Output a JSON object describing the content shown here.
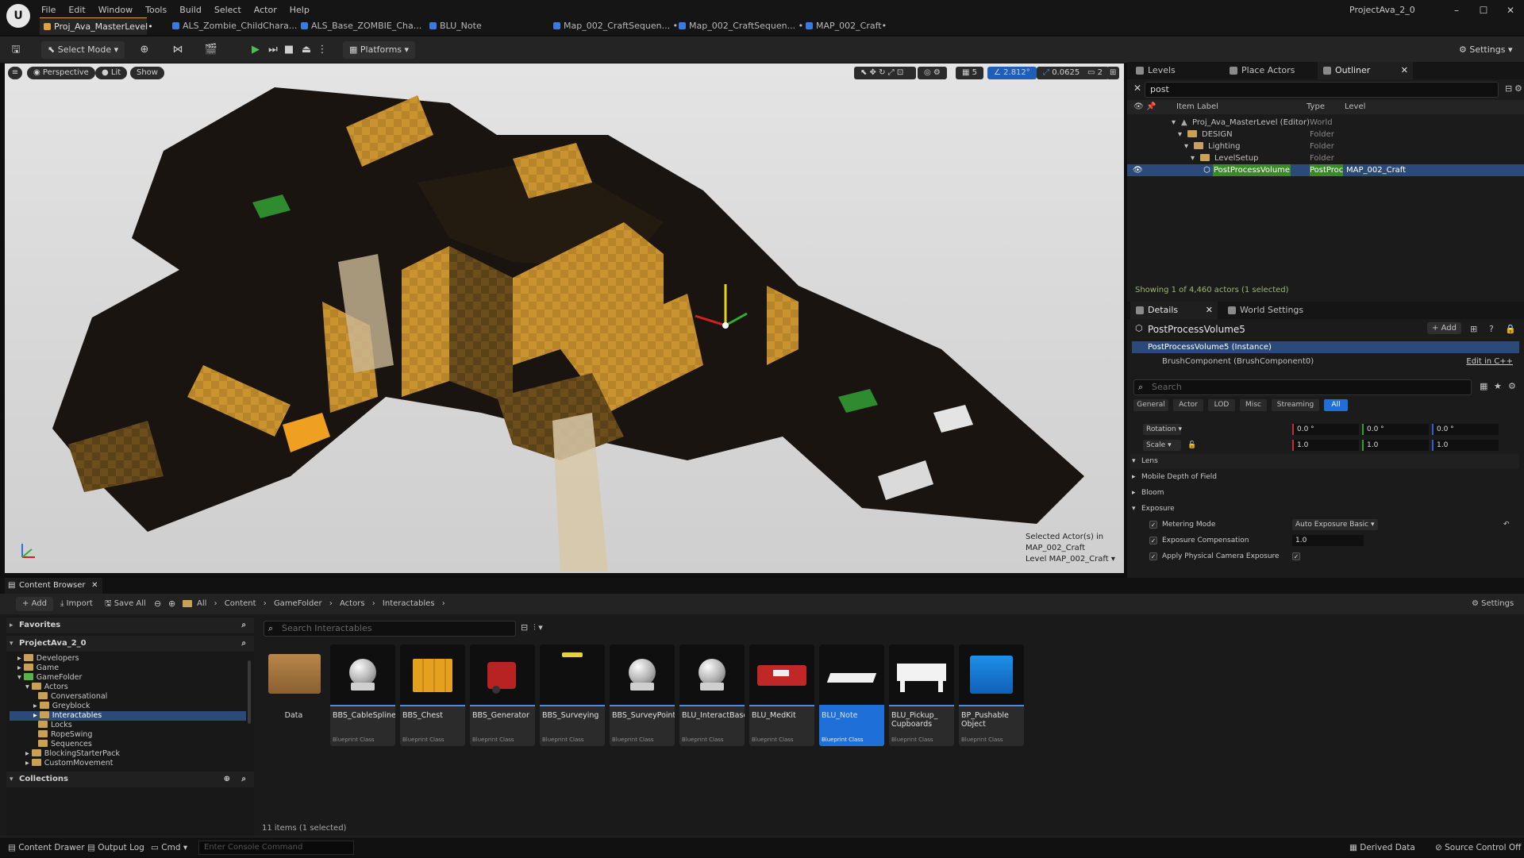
{
  "menu": {
    "items": [
      "File",
      "Edit",
      "Window",
      "Tools",
      "Build",
      "Select",
      "Actor",
      "Help"
    ],
    "project_name": "ProjectAva_2_0"
  },
  "tabs": [
    {
      "label": "Proj_Ava_MasterLevel•",
      "color": "#e0a040"
    },
    {
      "label": "ALS_Zombie_ChildChara...",
      "color": "#3a7be0"
    },
    {
      "label": "ALS_Base_ZOMBIE_Cha...",
      "color": "#3a7be0"
    },
    {
      "label": "BLU_Note",
      "color": "#3a7be0"
    },
    {
      "label": "Map_002_CraftSequen... •",
      "color": "#3a7be0"
    },
    {
      "label": "Map_002_CraftSequen... •",
      "color": "#3a7be0"
    },
    {
      "label": "MAP_002_Craft•",
      "color": "#3a7be0"
    }
  ],
  "toolbar": {
    "select_mode": "Select Mode",
    "platforms": "Platforms",
    "settings": "Settings"
  },
  "viewport": {
    "perspective": "Perspective",
    "lit": "Lit",
    "show": "Show",
    "grid_size": "5",
    "rotation_snap": "2.812°",
    "scale_snap": "0.0625",
    "camera_speed": "2",
    "selected_info_line1": "Selected Actor(s) in",
    "selected_info_line2": "MAP_002_Craft",
    "level_label": "Level",
    "level_value": "MAP_002_Craft"
  },
  "outliner": {
    "tabs": [
      "Levels",
      "Place Actors",
      "Outliner"
    ],
    "search_value": "post",
    "col_item": "Item Label",
    "col_type": "Type",
    "col_level": "Level",
    "rows": [
      {
        "label": "Proj_Ava_MasterLevel (Editor)",
        "type": "World",
        "level": ""
      },
      {
        "label": "DESIGN",
        "type": "Folder",
        "level": ""
      },
      {
        "label": "Lighting",
        "type": "Folder",
        "level": ""
      },
      {
        "label": "LevelSetup",
        "type": "Folder",
        "level": ""
      },
      {
        "label": "PostProcessVolume",
        "type": "PostProc",
        "level": "MAP_002_Craft"
      }
    ],
    "status": "Showing 1 of 4,460 actors (1 selected)"
  },
  "details": {
    "tabs": [
      "Details",
      "World Settings"
    ],
    "actor_name": "PostProcessVolume5",
    "add_label": "Add",
    "instance": "PostProcessVolume5 (Instance)",
    "component": "BrushComponent (BrushComponent0)",
    "edit_cpp": "Edit in C++",
    "search_placeholder": "Search",
    "filters": [
      "General",
      "Actor",
      "LOD",
      "Misc",
      "Streaming",
      "All"
    ],
    "rotation_label": "Rotation",
    "rotation": [
      "0.0 °",
      "0.0 °",
      "0.0 °"
    ],
    "scale_label": "Scale",
    "scale": [
      "1.0",
      "1.0",
      "1.0"
    ],
    "sections": [
      "Lens",
      "Mobile Depth of Field",
      "Bloom",
      "Exposure"
    ],
    "metering_mode_label": "Metering Mode",
    "metering_mode_value": "Auto Exposure Basic",
    "exposure_comp_label": "Exposure Compensation",
    "exposure_comp_value": "1.0",
    "physical_cam_label": "Apply Physical Camera Exposure"
  },
  "content_browser": {
    "tab": "Content Browser",
    "add": "Add",
    "import": "Import",
    "save_all": "Save All",
    "breadcrumb": [
      "All",
      "Content",
      "GameFolder",
      "Actors",
      "Interactables"
    ],
    "settings": "Settings",
    "favorites": "Favorites",
    "project": "ProjectAva_2_0",
    "collections": "Collections",
    "search_placeholder": "Search Interactables",
    "tree": [
      {
        "label": "Developers",
        "depth": 1
      },
      {
        "label": "Game",
        "depth": 1
      },
      {
        "label": "GameFolder",
        "depth": 1
      },
      {
        "label": "Actors",
        "depth": 2
      },
      {
        "label": "Conversational",
        "depth": 3
      },
      {
        "label": "Greyblock",
        "depth": 3
      },
      {
        "label": "Interactables",
        "depth": 3
      },
      {
        "label": "Locks",
        "depth": 3
      },
      {
        "label": "RopeSwing",
        "depth": 3
      },
      {
        "label": "Sequences",
        "depth": 3
      },
      {
        "label": "BlockingStarterPack",
        "depth": 1
      },
      {
        "label": "CustomMovement",
        "depth": 1
      }
    ],
    "folder_label": "Data",
    "assets": [
      {
        "name": "BBS_CableSpline",
        "cls": "Blueprint Class"
      },
      {
        "name": "BBS_Chest",
        "cls": "Blueprint Class"
      },
      {
        "name": "BBS_Generator",
        "cls": "Blueprint Class"
      },
      {
        "name": "BBS_Surveying",
        "cls": "Blueprint Class"
      },
      {
        "name": "BBS_SurveyPoints",
        "cls": "Blueprint Class"
      },
      {
        "name": "BLU_InteractBase",
        "cls": "Blueprint Class"
      },
      {
        "name": "BLU_MedKit",
        "cls": "Blueprint Class"
      },
      {
        "name": "BLU_Note",
        "cls": "Blueprint Class"
      },
      {
        "name": "BLU_Pickup_ Cupboards",
        "cls": "Blueprint Class"
      },
      {
        "name": "BP_Pushable Object",
        "cls": "Blueprint Class"
      }
    ],
    "count": "11 items (1 selected)"
  },
  "statusbar": {
    "content_drawer": "Content Drawer",
    "output_log": "Output Log",
    "cmd": "Cmd",
    "console_placeholder": "Enter Console Command",
    "derived_data": "Derived Data",
    "source_control": "Source Control Off"
  }
}
